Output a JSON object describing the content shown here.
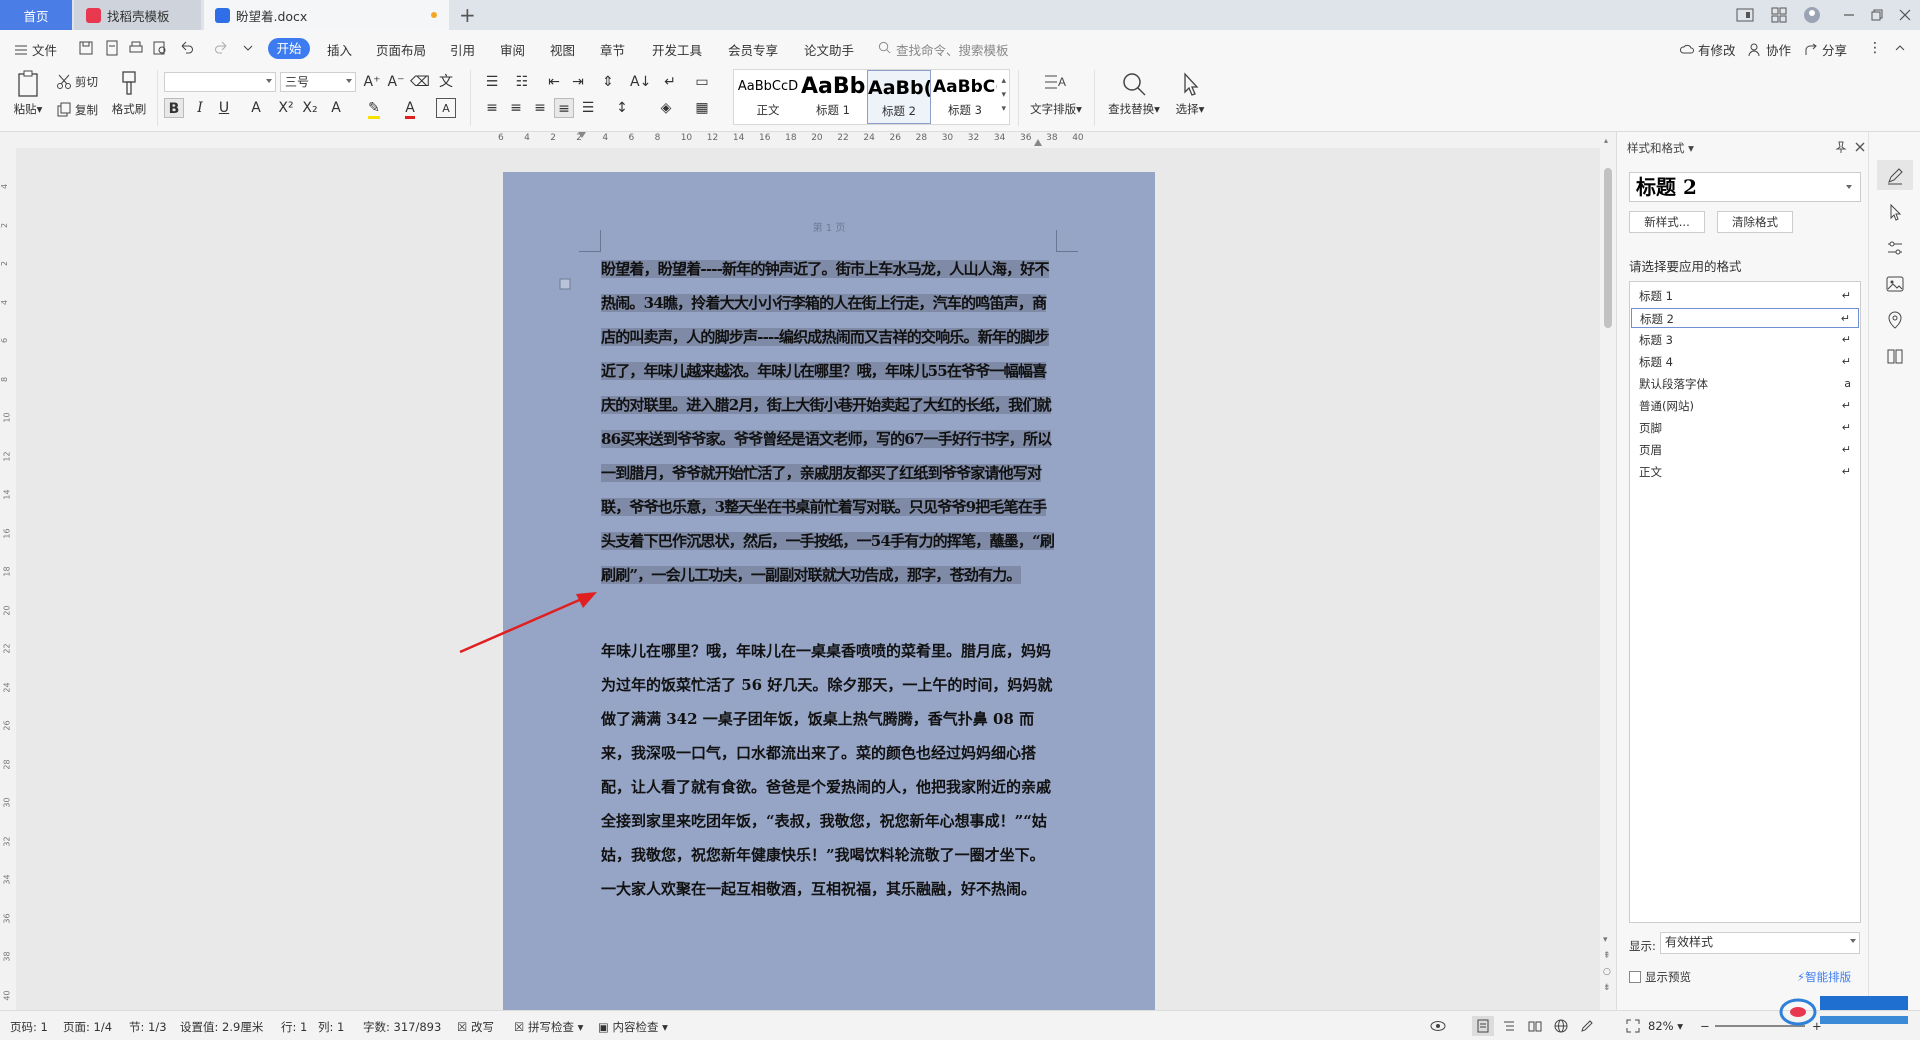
{
  "tabs": {
    "home": "首页",
    "template": "找稻壳模板",
    "document": "盼望着.docx",
    "add": "+"
  },
  "menu": {
    "file": "文件",
    "items": [
      "开始",
      "插入",
      "页面布局",
      "引用",
      "审阅",
      "视图",
      "章节",
      "开发工具",
      "会员专享",
      "论文助手"
    ],
    "search_placeholder": "查找命令、搜索模板",
    "has_changes": "有修改",
    "collab": "协作",
    "share": "分享"
  },
  "ribbon": {
    "paste": "粘贴",
    "cut": "剪切",
    "copy": "复制",
    "format_painter": "格式刷",
    "font_name": "",
    "font_size": "三号",
    "gallery": [
      {
        "preview": "AaBbCcD",
        "name": "正文"
      },
      {
        "preview": "AaBb",
        "name": "标题 1"
      },
      {
        "preview": "AaBb(",
        "name": "标题 2"
      },
      {
        "preview": "AaBbC(",
        "name": "标题 3"
      }
    ],
    "text_layout": "文字排版",
    "find_replace": "查找替换",
    "select": "选择"
  },
  "ruler": {
    "h_ticks": [
      "6",
      "4",
      "2",
      "2",
      "4",
      "6",
      "8",
      "10",
      "12",
      "14",
      "16",
      "18",
      "20",
      "22",
      "24",
      "26",
      "28",
      "30",
      "32",
      "34",
      "36",
      "38",
      "40"
    ],
    "v_ticks": [
      "4",
      "2",
      "2",
      "4",
      "6",
      "8",
      "10",
      "12",
      "14",
      "16",
      "18",
      "20",
      "22",
      "24",
      "26",
      "28",
      "30",
      "32",
      "34",
      "36",
      "38",
      "40"
    ]
  },
  "document": {
    "page_header": "第 1 页",
    "para1": "盼望着，盼望着----新年的钟声近了。街市上车水马龙，人山人海，好不热闹。34瞧，拎着大大小小行李箱的人在街上行走，汽车的鸣笛声，商店的叫卖声，人的脚步声----编织成热闹而又吉祥的交响乐。新年的脚步近了，年味儿越来越浓。年味儿在哪里？哦，年味儿55在爷爷一幅幅喜庆的对联里。进入腊2月，街上大街小巷开始卖起了大红的长纸，我们就86买来送到爷爷家。爷爷曾经是语文老师，写的67一手好行书字，所以一到腊月，爷爷就开始忙活了，亲戚朋友都买了红纸到爷爷家请他写对联，爷爷也乐意，3整天坐在书桌前忙着写对联。只见爷爷9把毛笔在手头支着下巴作沉思状，然后，一手按纸，一54手有力的挥笔，蘸墨，“刷刷刷”，一会儿工功夫，一副副对联就大功告成，那字，苍劲有力。",
    "para2": "年味儿在哪里？哦，年味儿在一桌桌香喷喷的菜肴里。腊月底，妈妈为过年的饭菜忙活了 56 好几天。除夕那天，一上午的时间，妈妈就做了满满 342 一桌子团年饭，饭桌上热气腾腾，香气扑鼻 08 而来，我深吸一口气，口水都流出来了。菜的颜色也经过妈妈细心搭配，让人看了就有食欲。爸爸是个爱热闹的人，他把我家附近的亲戚全接到家里来吃团年饭，“表叔，我敬您，祝您新年心想事成！”“姑姑，我敬您，祝您新年健康快乐！”我喝饮料轮流敬了一圈才坐下。一大家人欢聚在一起互相敬酒，互相祝福，其乐融融，好不热闹。"
  },
  "panel": {
    "title": "样式和格式",
    "current_style": "标题 2",
    "new_style": "新样式...",
    "clear_format": "清除格式",
    "apply_label": "请选择要应用的格式",
    "styles": [
      {
        "name": "标题 1",
        "mark": "↵"
      },
      {
        "name": "标题 2",
        "mark": "↵"
      },
      {
        "name": "标题 3",
        "mark": "↵"
      },
      {
        "name": "标题 4",
        "mark": "↵"
      },
      {
        "name": "默认段落字体",
        "mark": "a"
      },
      {
        "name": "普通(网站)",
        "mark": "↵"
      },
      {
        "name": "页脚",
        "mark": "↵"
      },
      {
        "name": "页眉",
        "mark": "↵"
      },
      {
        "name": "正文",
        "mark": "↵"
      }
    ],
    "show_label": "显示:",
    "show_value": "有效样式",
    "show_preview": "显示预览",
    "smart_layout": "智能排版"
  },
  "status": {
    "page_code": "页码: 1",
    "page": "页面: 1/4",
    "section": "节: 1/3",
    "setting": "设置值: 2.9厘米",
    "row": "行: 1",
    "col": "列: 1",
    "words": "字数: 317/893",
    "revise": "改写",
    "spell": "拼写检查",
    "content": "内容检查",
    "zoom": "82%"
  },
  "colors": {
    "accent": "#3d7cf0",
    "page_bg": "#96a5c6",
    "selection": "#7e8aa6",
    "arrow": "#e02020"
  }
}
